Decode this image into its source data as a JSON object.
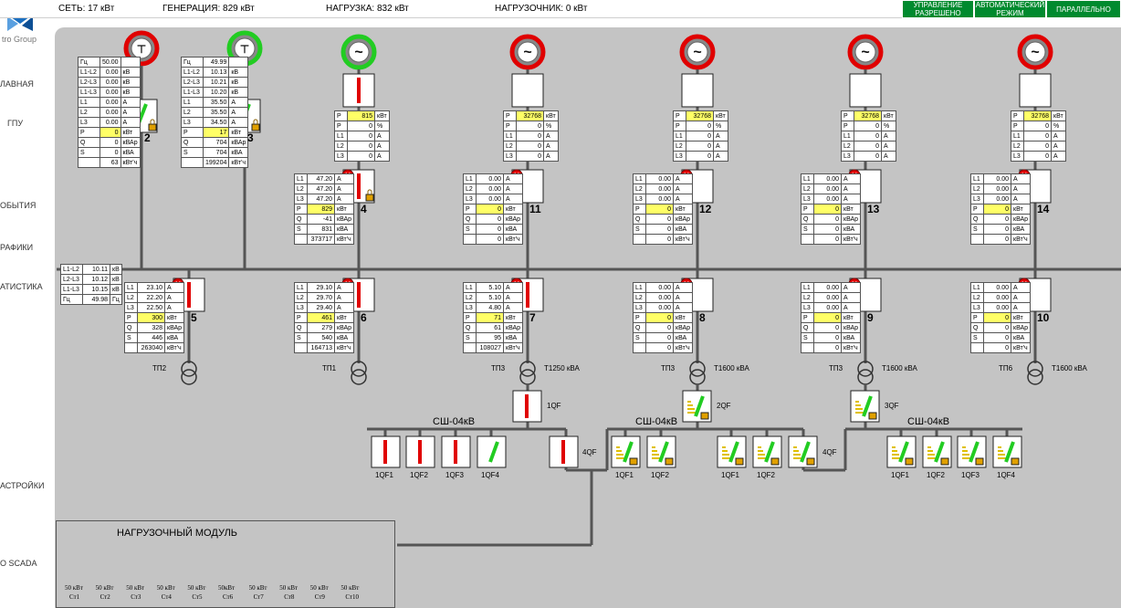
{
  "header": {
    "net": "СЕТЬ: 17 кВт",
    "gen": "ГЕНЕРАЦИЯ: 829 кВт",
    "load": "НАГРУЗКА: 832 кВт",
    "loadbank": "НАГРУЗОЧНИК: 0 кВт",
    "buttons": [
      "УПРАВЛЕНИЕ РАЗРЕШЕНО",
      "АВТОМАТИЧЕСКИЙ РЕЖИМ",
      "ПАРАЛЛЕЛЬНО"
    ]
  },
  "sidebar": {
    "logo_text": "tro Group",
    "items": [
      "ЛАВНАЯ",
      "ГПУ",
      "ОБЫТИЯ",
      "РАФИКИ",
      "АТИСТИКА",
      "АСТРОЙКИ",
      "O SCADA"
    ]
  },
  "colors": {
    "breaker_closed": "#e00000",
    "breaker_open_green": "#22cc22",
    "panel": "#c4c4c4"
  },
  "grid_inputs": [
    {
      "label": "2",
      "rows": [
        [
          "Гц",
          "50.00",
          ""
        ],
        [
          "L1-L2",
          "0.00",
          "кВ"
        ],
        [
          "L2-L3",
          "0.00",
          "кВ"
        ],
        [
          "L1-L3",
          "0.00",
          "кВ"
        ],
        [
          "L1",
          "0.00",
          "A"
        ],
        [
          "L2",
          "0.00",
          "A"
        ],
        [
          "L3",
          "0.00",
          "A"
        ],
        [
          "P",
          "0",
          "кВт"
        ],
        [
          "Q",
          "0",
          "кВАр"
        ],
        [
          "S",
          "0",
          "кВА"
        ],
        [
          "",
          "63",
          "кВт'ч"
        ]
      ]
    },
    {
      "label": "3",
      "rows": [
        [
          "Гц",
          "49.99",
          ""
        ],
        [
          "L1-L2",
          "10.13",
          "кВ"
        ],
        [
          "L2-L3",
          "10.21",
          "кВ"
        ],
        [
          "L1-L3",
          "10.20",
          "кВ"
        ],
        [
          "L1",
          "35.50",
          "A"
        ],
        [
          "L2",
          "35.50",
          "A"
        ],
        [
          "L3",
          "34.50",
          "A"
        ],
        [
          "P",
          "17",
          "кВт"
        ],
        [
          "Q",
          "704",
          "кВАр"
        ],
        [
          "S",
          "704",
          "кВА"
        ],
        [
          "",
          "199204",
          "кВт'ч"
        ]
      ]
    }
  ],
  "gens": [
    {
      "label": "4",
      "top": [
        [
          "P",
          "815",
          "кВт"
        ],
        [
          "P",
          "0",
          "%"
        ],
        [
          "L1",
          "0",
          "A"
        ],
        [
          "L2",
          "0",
          "A"
        ],
        [
          "L3",
          "0",
          "A"
        ]
      ],
      "br": [
        [
          "L1",
          "47.20",
          "A"
        ],
        [
          "L2",
          "47.20",
          "A"
        ],
        [
          "L3",
          "47.20",
          "A"
        ],
        [
          "P",
          "829",
          "кВт"
        ],
        [
          "Q",
          "-41",
          "кВАр"
        ],
        [
          "S",
          "831",
          "кВА"
        ],
        [
          "",
          "373717",
          "кВт'ч"
        ]
      ]
    },
    {
      "label": "11",
      "top": [
        [
          "P",
          "32768",
          "кВт"
        ],
        [
          "P",
          "0",
          "%"
        ],
        [
          "L1",
          "0",
          "A"
        ],
        [
          "L2",
          "0",
          "A"
        ],
        [
          "L3",
          "0",
          "A"
        ]
      ],
      "br": [
        [
          "L1",
          "0.00",
          "A"
        ],
        [
          "L2",
          "0.00",
          "A"
        ],
        [
          "L3",
          "0.00",
          "A"
        ],
        [
          "P",
          "0",
          "кВт"
        ],
        [
          "Q",
          "0",
          "кВАр"
        ],
        [
          "S",
          "0",
          "кВА"
        ],
        [
          "",
          "0",
          "кВт'ч"
        ]
      ]
    },
    {
      "label": "12",
      "top": [
        [
          "P",
          "32768",
          "кВт"
        ],
        [
          "P",
          "0",
          "%"
        ],
        [
          "L1",
          "0",
          "A"
        ],
        [
          "L2",
          "0",
          "A"
        ],
        [
          "L3",
          "0",
          "A"
        ]
      ],
      "br": [
        [
          "L1",
          "0.00",
          "A"
        ],
        [
          "L2",
          "0.00",
          "A"
        ],
        [
          "L3",
          "0.00",
          "A"
        ],
        [
          "P",
          "0",
          "кВт"
        ],
        [
          "Q",
          "0",
          "кВАр"
        ],
        [
          "S",
          "0",
          "кВА"
        ],
        [
          "",
          "0",
          "кВт'ч"
        ]
      ]
    },
    {
      "label": "13",
      "top": [
        [
          "P",
          "32768",
          "кВт"
        ],
        [
          "P",
          "0",
          "%"
        ],
        [
          "L1",
          "0",
          "A"
        ],
        [
          "L2",
          "0",
          "A"
        ],
        [
          "L3",
          "0",
          "A"
        ]
      ],
      "br": [
        [
          "L1",
          "0.00",
          "A"
        ],
        [
          "L2",
          "0.00",
          "A"
        ],
        [
          "L3",
          "0.00",
          "A"
        ],
        [
          "P",
          "0",
          "кВт"
        ],
        [
          "Q",
          "0",
          "кВАр"
        ],
        [
          "S",
          "0",
          "кВА"
        ],
        [
          "",
          "0",
          "кВт'ч"
        ]
      ]
    },
    {
      "label": "14",
      "top": [
        [
          "P",
          "32768",
          "кВт"
        ],
        [
          "P",
          "0",
          "%"
        ],
        [
          "L1",
          "0",
          "A"
        ],
        [
          "L2",
          "0",
          "A"
        ],
        [
          "L3",
          "0",
          "A"
        ]
      ],
      "br": [
        [
          "L1",
          "0.00",
          "A"
        ],
        [
          "L2",
          "0.00",
          "A"
        ],
        [
          "L3",
          "0.00",
          "A"
        ],
        [
          "P",
          "0",
          "кВт"
        ],
        [
          "Q",
          "0",
          "кВАр"
        ],
        [
          "S",
          "0",
          "кВА"
        ],
        [
          "",
          "0",
          "кВт'ч"
        ]
      ]
    }
  ],
  "bus_meter": [
    [
      "L1-L2",
      "10.11",
      "кВ"
    ],
    [
      "L2-L3",
      "10.12",
      "кВ"
    ],
    [
      "L1-L3",
      "10.15",
      "кВ"
    ],
    [
      "Гц",
      "49.98",
      "Гц"
    ]
  ],
  "feeders": [
    {
      "label": "5",
      "tp": "ТП2",
      "tr": "",
      "rows": [
        [
          "L1",
          "23.10",
          "A"
        ],
        [
          "L2",
          "22.20",
          "A"
        ],
        [
          "L3",
          "22.50",
          "A"
        ],
        [
          "P",
          "300",
          "кВт"
        ],
        [
          "Q",
          "328",
          "кВАр"
        ],
        [
          "S",
          "446",
          "кВА"
        ],
        [
          "",
          "263040",
          "кВт'ч"
        ]
      ]
    },
    {
      "label": "6",
      "tp": "ТП1",
      "tr": "",
      "rows": [
        [
          "L1",
          "29.10",
          "A"
        ],
        [
          "L2",
          "29.70",
          "A"
        ],
        [
          "L3",
          "29.40",
          "A"
        ],
        [
          "P",
          "461",
          "кВт"
        ],
        [
          "Q",
          "279",
          "кВАр"
        ],
        [
          "S",
          "540",
          "кВА"
        ],
        [
          "",
          "164713",
          "кВт'ч"
        ]
      ]
    },
    {
      "label": "7",
      "tp": "ТП3",
      "tr": "Т1250 кВА",
      "rows": [
        [
          "L1",
          "5.10",
          "A"
        ],
        [
          "L2",
          "5.10",
          "A"
        ],
        [
          "L3",
          "4.80",
          "A"
        ],
        [
          "P",
          "71",
          "кВт"
        ],
        [
          "Q",
          "61",
          "кВАр"
        ],
        [
          "S",
          "95",
          "кВА"
        ],
        [
          "",
          "108027",
          "кВт'ч"
        ]
      ]
    },
    {
      "label": "8",
      "tp": "ТП3",
      "tr": "Т1600 кВА",
      "rows": [
        [
          "L1",
          "0.00",
          "A"
        ],
        [
          "L2",
          "0.00",
          "A"
        ],
        [
          "L3",
          "0.00",
          "A"
        ],
        [
          "P",
          "0",
          "кВт"
        ],
        [
          "Q",
          "0",
          "кВАр"
        ],
        [
          "S",
          "0",
          "кВА"
        ],
        [
          "",
          "0",
          "кВт'ч"
        ]
      ]
    },
    {
      "label": "9",
      "tp": "ТП3",
      "tr": "Т1600 кВА",
      "rows": [
        [
          "L1",
          "0.00",
          "A"
        ],
        [
          "L2",
          "0.00",
          "A"
        ],
        [
          "L3",
          "0.00",
          "A"
        ],
        [
          "P",
          "0",
          "кВт"
        ],
        [
          "Q",
          "0",
          "кВАр"
        ],
        [
          "S",
          "0",
          "кВА"
        ],
        [
          "",
          "0",
          "кВт'ч"
        ]
      ]
    },
    {
      "label": "10",
      "tp": "ТП6",
      "tr": "Т1600 кВА",
      "rows": [
        [
          "L1",
          "0.00",
          "A"
        ],
        [
          "L2",
          "0.00",
          "A"
        ],
        [
          "L3",
          "0.00",
          "A"
        ],
        [
          "P",
          "0",
          "кВт"
        ],
        [
          "Q",
          "0",
          "кВАр"
        ],
        [
          "S",
          "0",
          "кВА"
        ],
        [
          "",
          "0",
          "кВт'ч"
        ]
      ]
    }
  ],
  "lv": {
    "bus_label": "СШ-04кВ",
    "qf_in": [
      "1QF",
      "2QF",
      "3QF"
    ],
    "qf_tie": "4QF",
    "groupA": [
      "1QF1",
      "1QF2",
      "1QF3",
      "1QF4"
    ],
    "groupB": [
      "1QF1",
      "1QF2"
    ],
    "groupC": [
      "1QF1",
      "1QF2"
    ],
    "groupD": [
      "1QF1",
      "1QF2",
      "1QF3",
      "1QF4"
    ]
  },
  "load_module": {
    "title": "НАГРУЗОЧНЫЙ МОДУЛЬ",
    "steps": [
      [
        "50 кВт",
        "Ст1"
      ],
      [
        "50 кВт",
        "Ст2"
      ],
      [
        "50 кВт",
        "Ст3"
      ],
      [
        "50 кВт",
        "Ст4"
      ],
      [
        "50 кВт",
        "Ст5"
      ],
      [
        "50кВт",
        "Ст6"
      ],
      [
        "50 кВт",
        "Ст7"
      ],
      [
        "50 кВт",
        "Ст8"
      ],
      [
        "50 кВт",
        "Ст9"
      ],
      [
        "50 кВт",
        "Ст10"
      ]
    ]
  }
}
